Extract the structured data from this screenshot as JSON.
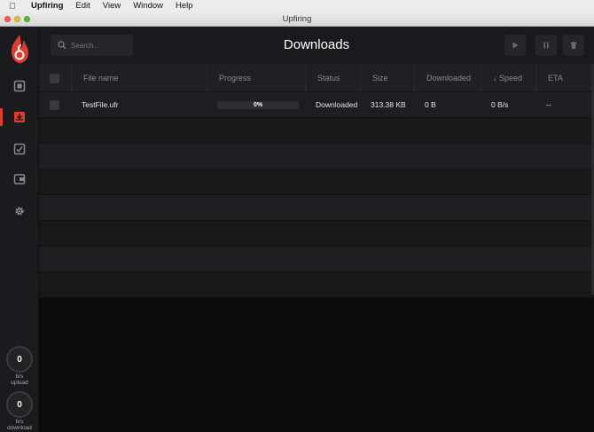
{
  "menubar": {
    "app": "Upfiring",
    "items": [
      "Edit",
      "View",
      "Window",
      "Help"
    ]
  },
  "window": {
    "title": "Upfiring"
  },
  "colors": {
    "accent": "#e23b2e",
    "background": "#0b0b0c",
    "sidebar": "#1b1b1d"
  },
  "sidebar": {
    "items": [
      {
        "icon": "box-icon",
        "active": false
      },
      {
        "icon": "download-tray-icon",
        "active": true
      },
      {
        "icon": "check-square-icon",
        "active": false
      },
      {
        "icon": "wallet-icon",
        "active": false
      },
      {
        "icon": "gear-icon",
        "active": false
      }
    ],
    "upload": {
      "value": "0",
      "unit": "b/s",
      "label": "upload"
    },
    "download": {
      "value": "0",
      "unit": "b/s",
      "label": "download"
    }
  },
  "header": {
    "search_placeholder": "Search...",
    "title": "Downloads"
  },
  "table": {
    "columns": [
      "File name",
      "Progress",
      "Status",
      "Size",
      "Downloaded",
      "↓ Speed",
      "ETA"
    ],
    "rows": [
      {
        "file_name": "TestFile.ufr",
        "progress": 0,
        "progress_label": "0%",
        "status": "Downloaded",
        "size": "313.38 KB",
        "downloaded": "0 B",
        "speed": "0 B/s",
        "eta": "--"
      }
    ]
  }
}
